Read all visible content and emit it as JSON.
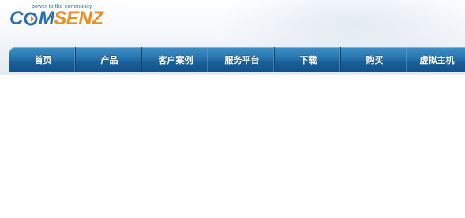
{
  "header": {
    "tagline": "power to the community",
    "logo": {
      "part1": "C",
      "part2": "MSENZ",
      "full_text": "COMSENZ",
      "brand_colors": {
        "blue": "#2a6db4",
        "orange": "#f08c1e"
      }
    }
  },
  "nav": {
    "items": [
      {
        "label": "首页"
      },
      {
        "label": "产品"
      },
      {
        "label": "客户案例"
      },
      {
        "label": "服务平台"
      },
      {
        "label": "下载"
      },
      {
        "label": "购买"
      },
      {
        "label": "虚拟主机"
      }
    ],
    "colors": {
      "bar_top": "#3d8fc6",
      "bar_bottom": "#125188",
      "divider": "#0f4677",
      "text": "#ffffff"
    }
  }
}
